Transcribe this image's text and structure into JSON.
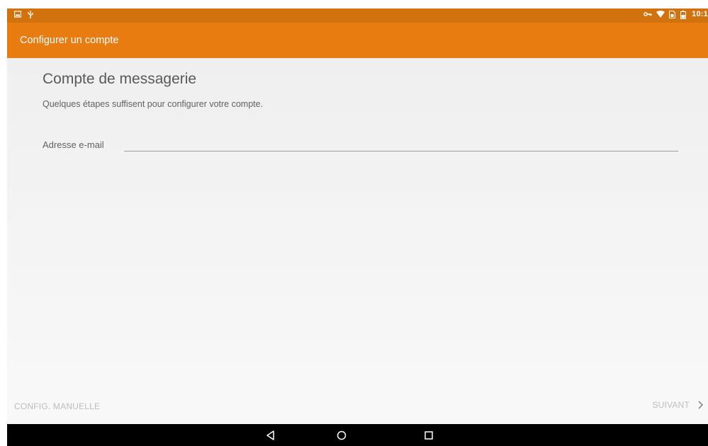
{
  "status_bar": {
    "time": "10:1",
    "left_icons": [
      "screenshot-icon",
      "usb-icon"
    ],
    "right_icons": [
      "vpn-key-icon",
      "wifi-icon",
      "sim-icon",
      "battery-icon"
    ]
  },
  "app_bar": {
    "title": "Configurer un compte"
  },
  "form": {
    "heading": "Compte de messagerie",
    "subtitle": "Quelques étapes suffisent pour configurer votre compte.",
    "email_label": "Adresse e-mail",
    "email_value": "",
    "email_placeholder": ""
  },
  "actions": {
    "manual_label": "CONFIG. MANUELLE",
    "next_label": "SUIVANT"
  },
  "nav_bar": {
    "buttons": [
      "back-icon",
      "home-icon",
      "recents-icon"
    ]
  },
  "colors": {
    "status_bar": "#d2720e",
    "app_bar": "#e87c11",
    "disabled_text": "#bdbdbd"
  }
}
